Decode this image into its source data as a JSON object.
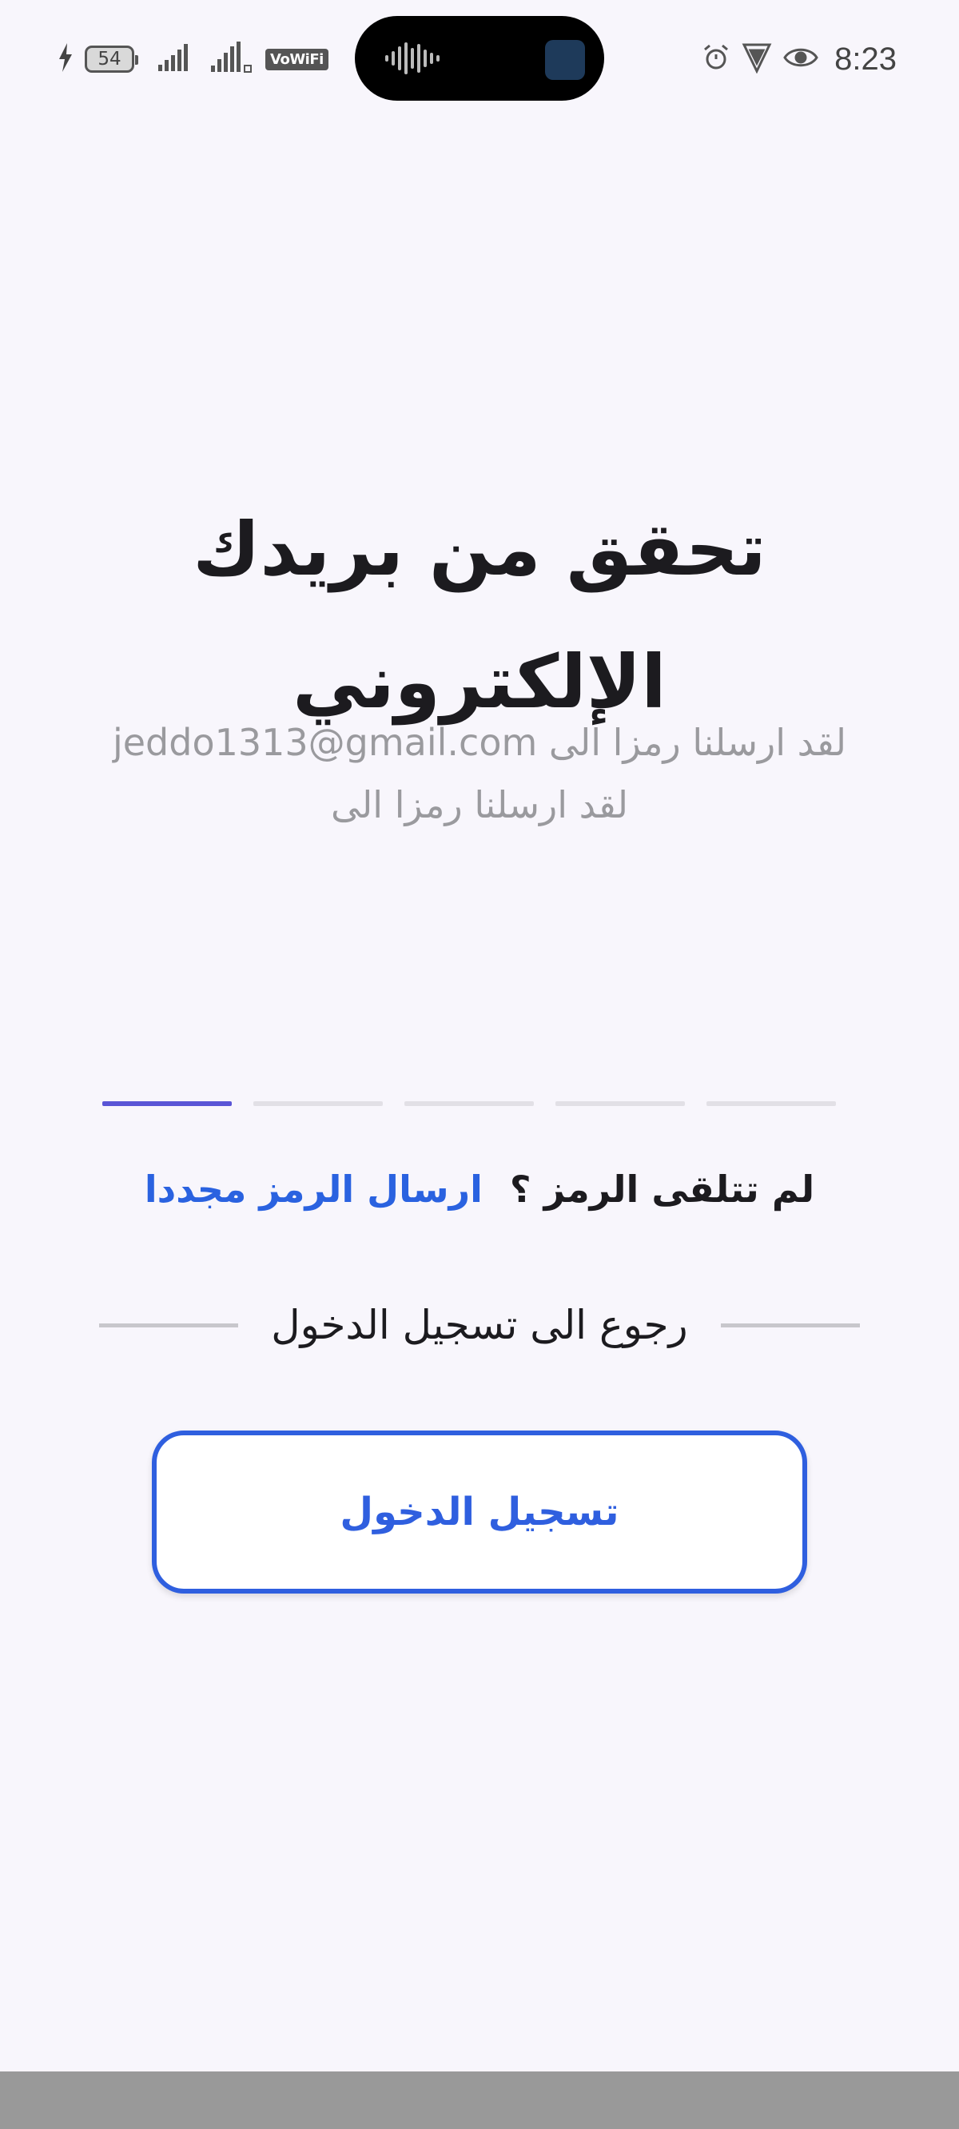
{
  "status_bar": {
    "battery_level": "54",
    "network_badge": "VoWiFi",
    "time": "8:23",
    "icons": [
      "charging-icon",
      "battery-icon",
      "signal-icon",
      "signal-icon",
      "vowifi-icon",
      "alarm-icon",
      "vpn-shield-icon",
      "eye-icon"
    ]
  },
  "verify": {
    "title_line1": "تحقق من بريدك",
    "title_line2": "الإلكتروني",
    "subtitle_line1": "لقد ارسلنا رمزا الى  jeddo1313@gmail.com",
    "subtitle_line2": "لقد ارسلنا رمزا الى",
    "otp": {
      "slots": 5,
      "active_index": 0
    },
    "resend_question": "لم تتلقى الرمز ؟",
    "resend_link": "ارسال الرمز مجددا",
    "back_to_login": "رجوع الى تسجيل الدخول",
    "login_button": "تسجيل الدخول"
  },
  "colors": {
    "accent": "#2f5fdf",
    "otp_active": "#5a55d6",
    "background": "#f8f6fc",
    "muted_text": "#9a9a9e"
  }
}
